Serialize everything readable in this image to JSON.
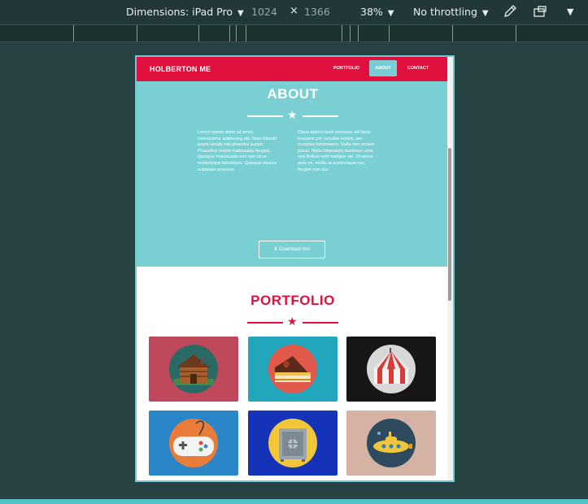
{
  "devtools": {
    "dimensions_label": "Dimensions: iPad Pro",
    "width": "1024",
    "times": "×",
    "height": "1366",
    "zoom": "38%",
    "throttling": "No throttling"
  },
  "site": {
    "brand": "HOLBERTON ME",
    "nav": [
      "PORTFOLIO",
      "ABOUT",
      "CONTACT"
    ],
    "active_nav": "ABOUT",
    "about": {
      "title": "ABOUT",
      "col1": "Lorem ipsum dolor sit amet, consectetur adipiscing elit. Nam blandit turpis iaculis nisl pharetra auctor. Phasellus mattis malesuada feugiat. Quisque malesuada orci non risus scelerisque bibendum. Quisque viverra vulputate posuere.",
      "col2": "Class aptent taciti sociosqu ad litora torquent per conubia nostra, per inceptos himenaeos. Nulla non ornare purus. Nulla bibendum maximus urna, sed finibus velit tristique vel. Vivamus ante mi, mollis at scelerisque nec, feugiat non dui.",
      "download": "Download me!"
    },
    "portfolio": {
      "title": "PORTFOLIO",
      "items": [
        {
          "icon": "cabin-icon",
          "bg": "#c0485c"
        },
        {
          "icon": "cake-icon",
          "bg": "#22a6bb"
        },
        {
          "icon": "circus-tent-icon",
          "bg": "#181515"
        },
        {
          "icon": "game-controller-icon",
          "bg": "#2b86c8"
        },
        {
          "icon": "safe-icon",
          "bg": "#1533b8"
        },
        {
          "icon": "submarine-icon",
          "bg": "#d4b2a4"
        }
      ]
    }
  },
  "colors": {
    "brand_red": "#e0103f",
    "about_teal": "#7acfd3",
    "page_bg": "#284142"
  }
}
